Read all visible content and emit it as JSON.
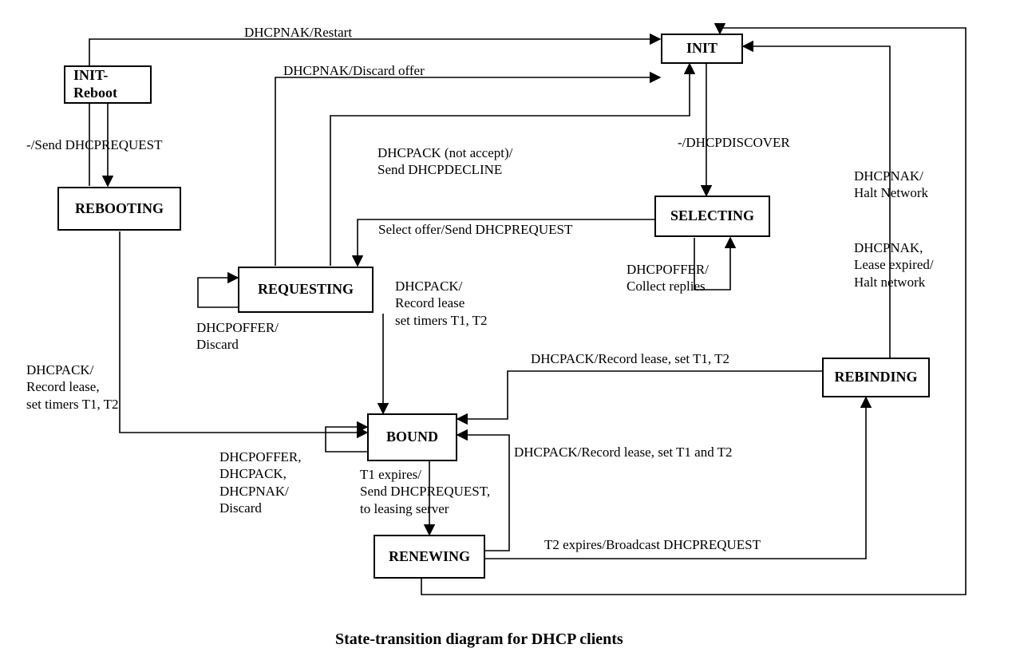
{
  "caption": "State-transition diagram for DHCP clients",
  "states": {
    "init_reboot": "INIT-\nReboot",
    "rebooting": "REBOOTING",
    "requesting": "REQUESTING",
    "bound": "BOUND",
    "renewing": "RENEWING",
    "selecting": "SELECTING",
    "rebinding": "REBINDING",
    "init": "INIT"
  },
  "labels": {
    "e_initreboot_rebooting": "-/Send DHCPREQUEST",
    "e_rebooting_init": "DHCPNAK/Restart",
    "e_rebooting_bound": "DHCPACK/\nRecord lease,\nset timers T1, T2",
    "e_requesting_self": "DHCPOFFER/\nDiscard",
    "e_requesting_init_nak": "DHCPNAK/Discard offer",
    "e_requesting_init_ack": "DHCPACK (not accept)/\nSend DHCPDECLINE",
    "e_requesting_bound": "DHCPACK/\nRecord lease\nset timers T1, T2",
    "e_selecting_requesting": "Select offer/Send DHCPREQUEST",
    "e_selecting_self": "DHCPOFFER/\nCollect replies",
    "e_init_selecting": "-/DHCPDISCOVER",
    "e_bound_self": "DHCPOFFER,\nDHCPACK,\nDHCPNAK/\nDiscard",
    "e_bound_renewing": "T1 expires/\nSend DHCPREQUEST,\nto leasing server",
    "e_renewing_bound": "DHCPACK/Record lease, set T1 and T2",
    "e_renewing_rebinding": "T2 expires/Broadcast DHCPREQUEST",
    "e_renewing_init": "DHCPNAK/\nHalt Network",
    "e_rebinding_bound": "DHCPACK/Record lease, set T1, T2",
    "e_rebinding_init": "DHCPNAK,\nLease expired/\nHalt network"
  }
}
